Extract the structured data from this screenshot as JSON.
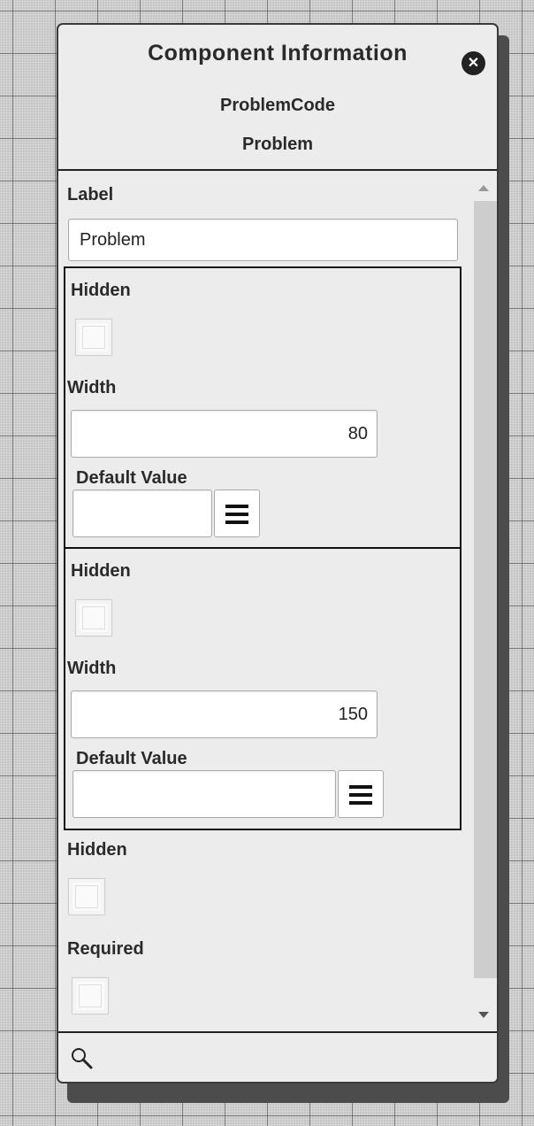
{
  "panel": {
    "title": "Component Information",
    "subtitle_code": "ProblemCode",
    "subtitle_name": "Problem"
  },
  "label_section": {
    "label": "Label",
    "value": "Problem"
  },
  "group1": {
    "hidden_label": "Hidden",
    "width_label": "Width",
    "width_value": "80",
    "default_label": "Default Value",
    "default_value": ""
  },
  "group2": {
    "hidden_label": "Hidden",
    "width_label": "Width",
    "width_value": "150",
    "default_label": "Default Value",
    "default_value": ""
  },
  "bottom": {
    "hidden_label": "Hidden",
    "required_label": "Required"
  },
  "icons": {
    "close": "close-icon",
    "menu": "menu-icon",
    "search": "search-icon"
  }
}
